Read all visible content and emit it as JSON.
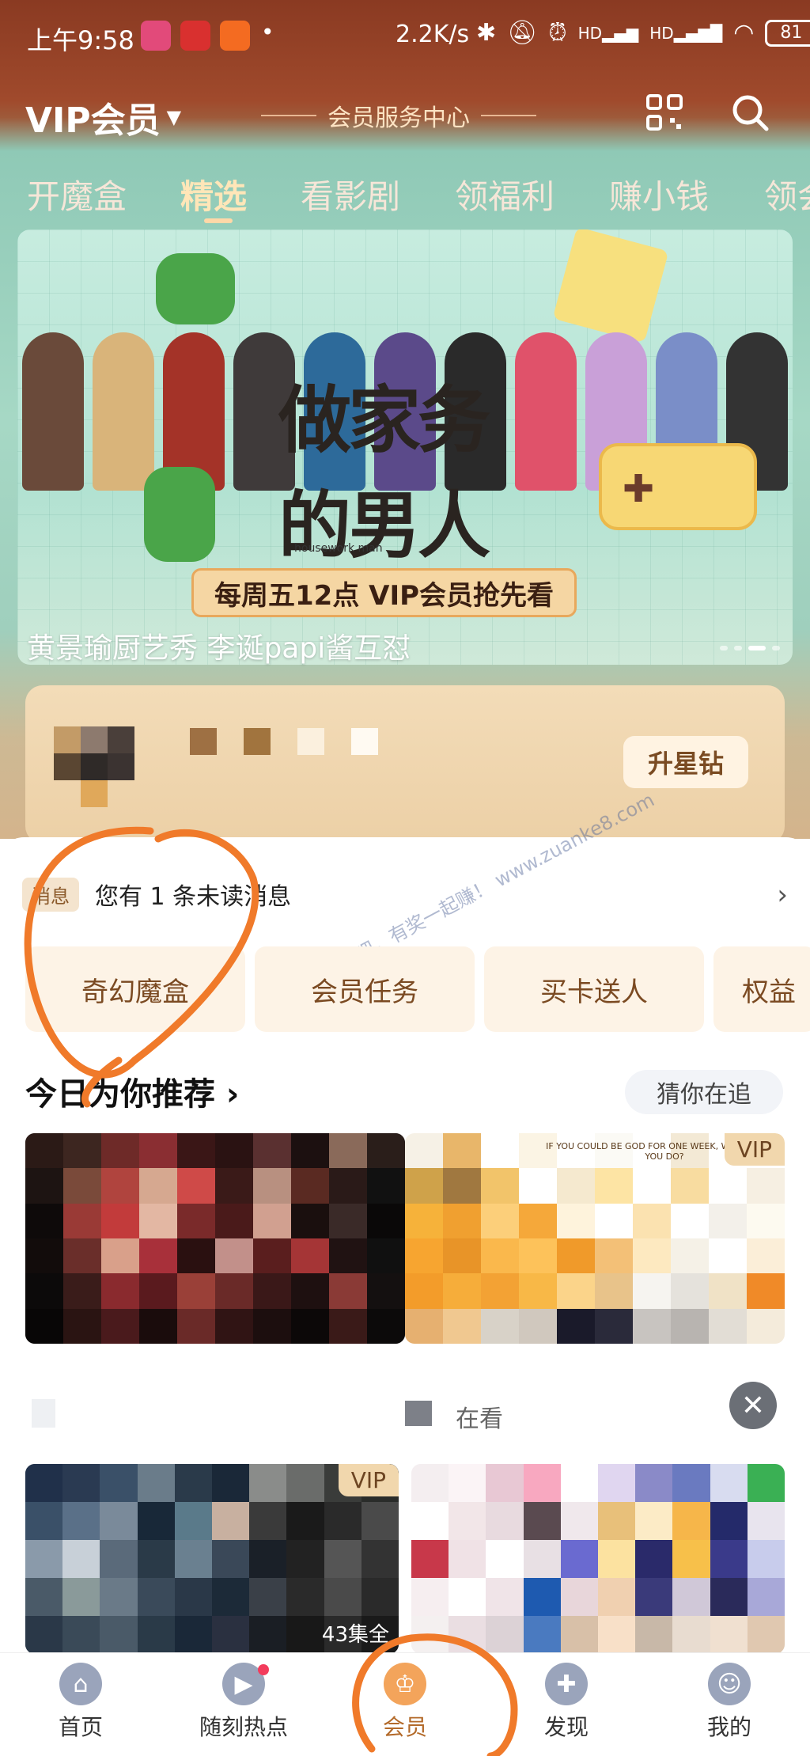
{
  "status_bar": {
    "time": "上午9:58",
    "network_speed": "2.2K/s",
    "battery": "81",
    "signal_label_1": "HD",
    "signal_label_2": "HD"
  },
  "header": {
    "title": "VIP会员",
    "center_title": "会员服务中心"
  },
  "tabs": [
    {
      "label": "开魔盒"
    },
    {
      "label": "精选",
      "active": true
    },
    {
      "label": "看影剧"
    },
    {
      "label": "领福利"
    },
    {
      "label": "赚小钱"
    },
    {
      "label": "领会"
    }
  ],
  "banner": {
    "show_title": "做家务的男人",
    "show_subtitle": "housework man",
    "tagline": "每周五12点  VIP会员抢先看",
    "caption": "黄景瑜厨艺秀 李诞papi酱互怼"
  },
  "member_card": {
    "upgrade_label": "升星钻"
  },
  "messages": {
    "tag": "消息",
    "text": "您有 1 条未读消息"
  },
  "quick_actions": [
    {
      "label": "奇幻魔盒"
    },
    {
      "label": "会员任务"
    },
    {
      "label": "买卡送人"
    },
    {
      "label": "权益"
    }
  ],
  "recommend": {
    "title": "今日为你推荐 ›",
    "guess_label": "猜你在追",
    "vip_label": "VIP",
    "poster_text": "IF YOU COULD BE GOD FOR ONE WEEK, WHAT WOULD YOU DO?",
    "row_caption_2": "在看",
    "episode_text": "43集全",
    "close_symbol": "✕"
  },
  "watermark": "赚客吧，有奖一起赚！ www.zuanke8.com",
  "bottom_nav": [
    {
      "label": "首页",
      "icon": "home-icon"
    },
    {
      "label": "随刻热点",
      "icon": "flame-icon"
    },
    {
      "label": "会员",
      "icon": "crown-icon",
      "active": true
    },
    {
      "label": "发现",
      "icon": "plus-circle-icon"
    },
    {
      "label": "我的",
      "icon": "profile-icon"
    }
  ],
  "colors": {
    "header_brown": "#8a3a22",
    "accent_gold": "#f1d7ad",
    "annotation_orange": "#f07a2a"
  }
}
